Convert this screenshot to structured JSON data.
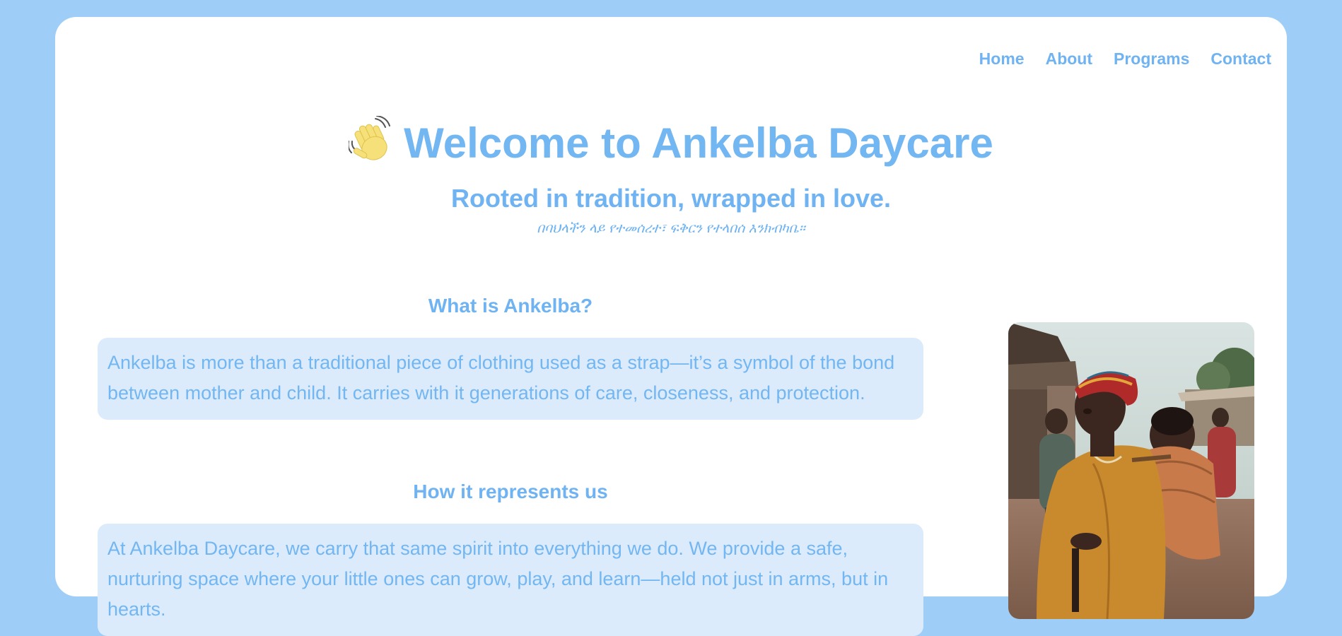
{
  "nav": {
    "items": [
      {
        "label": "Home"
      },
      {
        "label": "About"
      },
      {
        "label": "Programs"
      },
      {
        "label": "Contact"
      }
    ]
  },
  "hero": {
    "icon": "waving-hand-icon",
    "title": "Welcome to Ankelba Daycare",
    "subtitle": "Rooted in tradition, wrapped in love.",
    "subtitle_amharic": "በባህላችን ላይ የተመሰረተ፣ ፍቅርን የተላበሰ እንክብካቤ።"
  },
  "sections": [
    {
      "heading": "What is Ankelba?",
      "body": "Ankelba is more than a traditional piece of clothing used as a strap—it’s a symbol of the bond between mother and child. It carries with it generations of care, closeness, and protection."
    },
    {
      "heading": "How it represents us",
      "body": "At Ankelba Daycare, we carry that same spirit into everything we do. We provide a safe, nurturing space where your little ones can grow, play, and learn—held not just in arms, but in hearts."
    }
  ],
  "colors": {
    "page_background": "#9ecef8",
    "card_background": "#ffffff",
    "accent": "#6fb3f2",
    "text_box_background": "#dcebfc"
  }
}
